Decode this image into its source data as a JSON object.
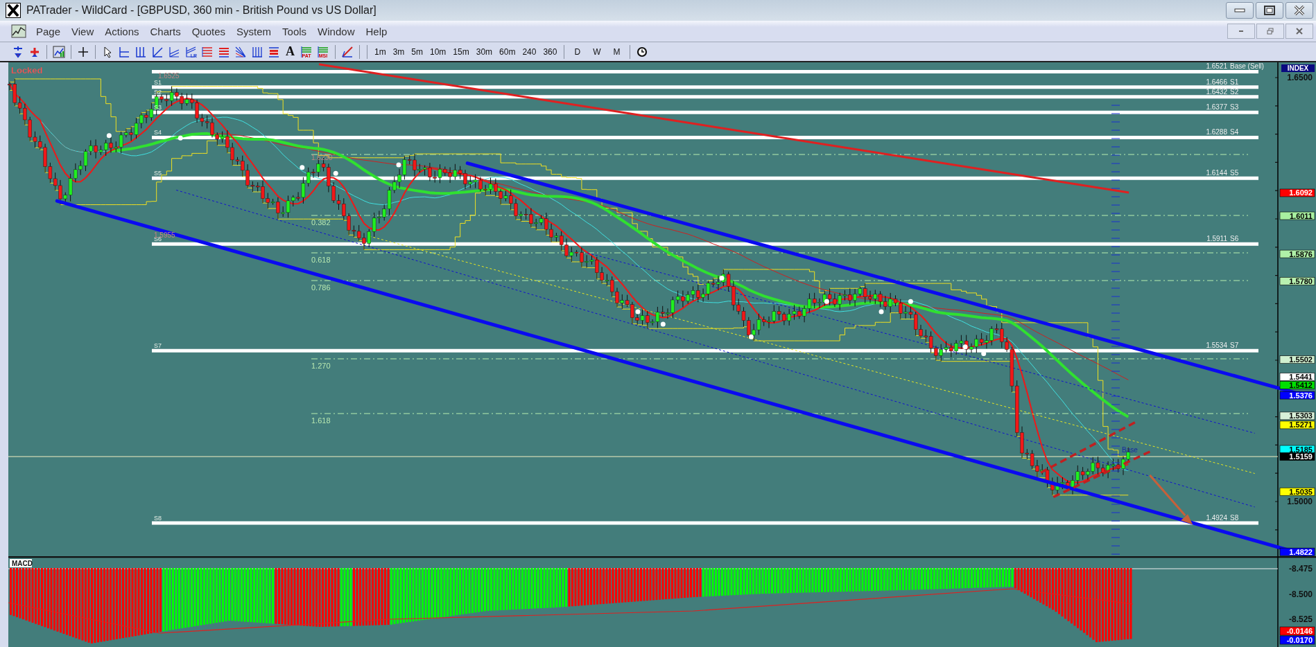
{
  "window": {
    "title": "PATrader - WildCard - [GBPUSD, 360 min - British Pound vs US Dollar]"
  },
  "menu": [
    "Page",
    "View",
    "Actions",
    "Charts",
    "Quotes",
    "System",
    "Tools",
    "Window",
    "Help"
  ],
  "toolbar": {
    "badges": [
      "LR",
      "PAT",
      "MSI"
    ],
    "text_tool": "A",
    "timeframes": [
      "1m",
      "3m",
      "5m",
      "10m",
      "15m",
      "30m",
      "60m",
      "240",
      "360"
    ],
    "periods": [
      "D",
      "W",
      "M"
    ]
  },
  "chart": {
    "status": "Locked",
    "pivots": [
      {
        "value": "1.6521",
        "right_label": "Base (Sell)"
      },
      {
        "value": "1.6466",
        "left_label": "S1",
        "right_label": "S1"
      },
      {
        "value": "1.6432",
        "left_label": "S2",
        "right_label": "S2"
      },
      {
        "value": "1.6377",
        "left_label": "S3",
        "right_label": "S3"
      },
      {
        "value": "1.6288",
        "left_label": "S4",
        "right_label": "S4"
      },
      {
        "value": "1.6144",
        "left_label": "S5",
        "right_label": "S5"
      },
      {
        "value": "1.5911",
        "left_label": "S6",
        "right_label": "S6"
      },
      {
        "value": "1.5534",
        "left_label": "S7",
        "right_label": "S7"
      },
      {
        "value": "1.4924",
        "left_label": "S8",
        "right_label": "S8"
      }
    ],
    "fib_labels": [
      "0.382",
      "0.618",
      "0.786",
      "1.270",
      "1.618"
    ],
    "swing_labels": [
      "1.6525",
      "1.5955",
      "1.6230"
    ],
    "base_label": "Base"
  },
  "axis": {
    "header": "INDEX",
    "ticks": [
      "1.6500",
      "1.5000"
    ],
    "tags": [
      {
        "text": "1.6092",
        "color": "#ff0000"
      },
      {
        "text": "1.6011",
        "color": "#a8f0a0"
      },
      {
        "text": "1.5876",
        "color": "#b0f0a8"
      },
      {
        "text": "1.5780",
        "color": "#b8f0b0"
      },
      {
        "text": "1.5502",
        "color": "#d0f0d0"
      },
      {
        "text": "1.5441",
        "color": "#ffffff"
      },
      {
        "text": "1.5412",
        "color": "#00e000"
      },
      {
        "text": "1.5376",
        "color": "#0000ff"
      },
      {
        "text": "1.5303",
        "color": "#d8f0d8"
      },
      {
        "text": "1.5271",
        "color": "#ffff00"
      },
      {
        "text": "1.5185",
        "color": "#00ffff"
      },
      {
        "text": "1.5159",
        "color": "#000000"
      },
      {
        "text": "1.5035",
        "color": "#ffff00"
      },
      {
        "text": "1.4822",
        "color": "#0000ff"
      }
    ]
  },
  "macd": {
    "title": "MACD",
    "ticks": [
      "-8.475",
      "-8.500",
      "-8.525"
    ],
    "tags": [
      {
        "text": "-0.0146",
        "color": "#ff0000"
      },
      {
        "text": "-0.0170",
        "color": "#0000ff"
      }
    ]
  }
}
